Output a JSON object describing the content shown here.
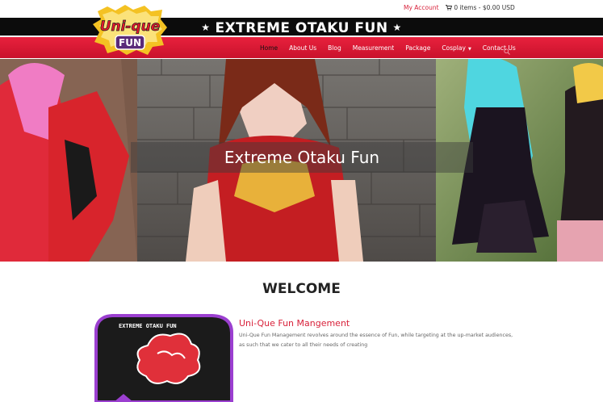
{
  "topbar": {
    "account_label": "My Account",
    "cart_label": "0 items - $0.00 USD"
  },
  "logo": {
    "line1": "Uni-que",
    "line2": "FUN"
  },
  "header": {
    "tagline": "EXTREME OTAKU FUN"
  },
  "nav": {
    "items": [
      {
        "label": "Home",
        "active": true
      },
      {
        "label": "About Us"
      },
      {
        "label": "Blog"
      },
      {
        "label": "Measurement"
      },
      {
        "label": "Package"
      },
      {
        "label": "Cosplay"
      },
      {
        "label": "Contact Us"
      }
    ]
  },
  "hero": {
    "title": "Extreme Otaku Fun"
  },
  "main": {
    "heading": "WELCOME",
    "section_title": "Uni-Que Fun Mangement",
    "section_text": "Uni-Que Fun Management revolves around the essence of Fun, while targeting at the up-market audiences, as such that we cater to all their needs of creating",
    "badge_text": "EXTREME OTAKU FUN"
  },
  "colors": {
    "brand_red": "#d8213a",
    "header_black": "#0c0c0c"
  }
}
